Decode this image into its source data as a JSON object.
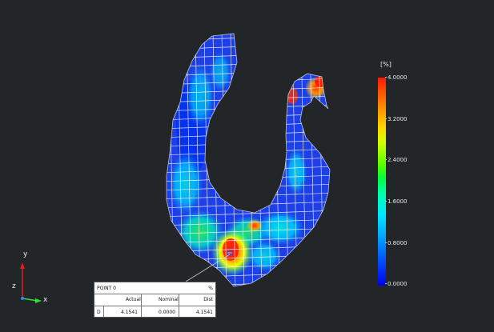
{
  "triad": {
    "y_label": "y",
    "z_label": "z",
    "x_label": "x"
  },
  "scale": {
    "unit": "[%]",
    "ticks": [
      "4.0000",
      "3.2000",
      "2.4000",
      "1.6000",
      "0.8000",
      "0.0000"
    ],
    "max": 4.0,
    "min": 0.0
  },
  "colors": {
    "background": "#232628",
    "high": "#ff1a00",
    "low": "#0000e8",
    "mesh_line": "#ffffff"
  },
  "point_table": {
    "title": "POINT 0",
    "unit": "%",
    "headers": {
      "actual": "Actual",
      "nominal": "Nominal",
      "dist": "Dist"
    },
    "row": {
      "label": "D",
      "actual": "4.1541",
      "nominal": "0.0000",
      "dist": "4.1541"
    }
  }
}
